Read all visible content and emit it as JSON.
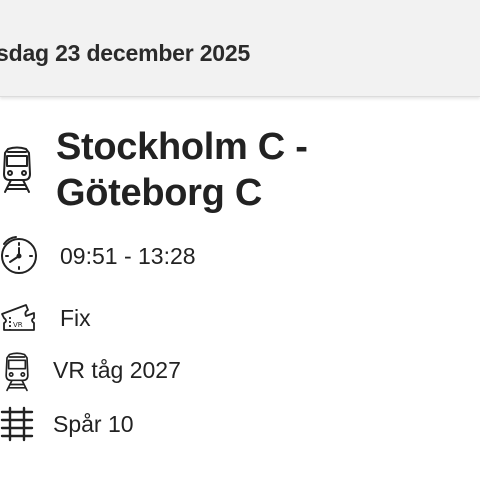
{
  "header": {
    "date": "sdag 23 december 2025"
  },
  "trip": {
    "route": "Stockholm C - Göteborg C",
    "time": "09:51 - 13:28",
    "ticket_type": "Fix",
    "ticket_icon_text": "VR",
    "train": "VR tåg 2027",
    "track": "Spår 10"
  },
  "icons": [
    "train-icon",
    "clock-icon",
    "ticket-icon",
    "train-icon",
    "track-icon"
  ],
  "colors": {
    "header_bg": "#f2f2f2",
    "text": "#222222"
  }
}
